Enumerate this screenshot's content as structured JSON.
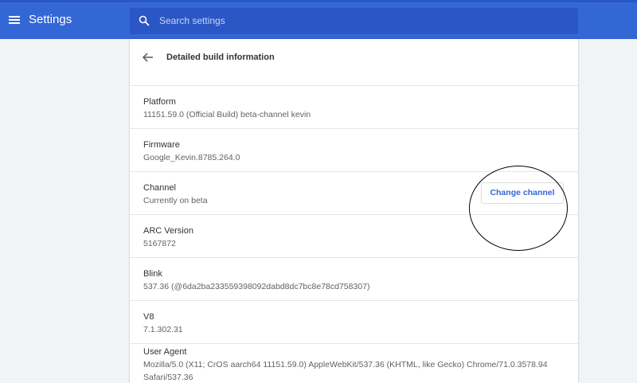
{
  "header": {
    "title": "Settings",
    "menu_icon": "hamburger-menu-icon",
    "search": {
      "placeholder": "Search settings",
      "value": "",
      "icon": "search-icon"
    },
    "colors": {
      "toolbar": "#3367d6",
      "search_box": "#2a56c6"
    }
  },
  "page": {
    "title": "Detailed build information",
    "back_icon": "arrow-back-icon"
  },
  "rows": [
    {
      "label": "Platform",
      "value": "11151.59.0 (Official Build) beta-channel kevin"
    },
    {
      "label": "Firmware",
      "value": "Google_Kevin.8785.264.0"
    },
    {
      "label": "Channel",
      "value": "Currently on beta",
      "button_label": "Change channel"
    },
    {
      "label": "ARC Version",
      "value": "5167872"
    },
    {
      "label": "Blink",
      "value": "537.36 (@6da2ba233559398092dabd8dc7bc8e78cd758307)"
    },
    {
      "label": "V8",
      "value": "7.1.302.31"
    },
    {
      "label": "User Agent",
      "value": "Mozilla/5.0 (X11; CrOS aarch64 11151.59.0) AppleWebKit/537.36 (KHTML, like Gecko) Chrome/71.0.3578.94 Safari/537.36"
    }
  ]
}
